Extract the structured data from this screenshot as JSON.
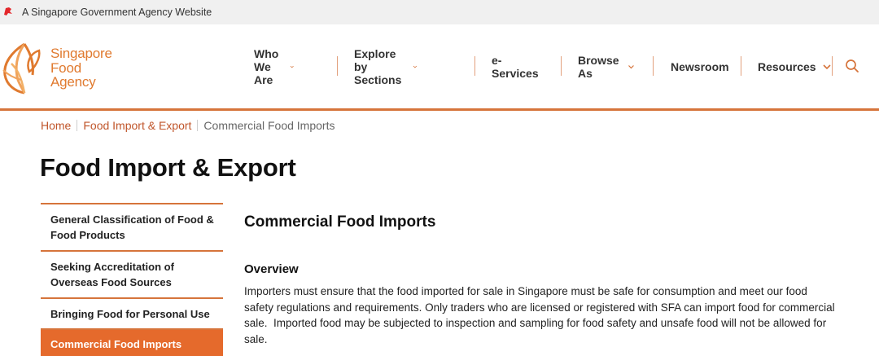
{
  "gov_bar": {
    "text": "A Singapore Government Agency Website",
    "logo_icon": "singapore-lion-icon",
    "logo_color": "#e3262a"
  },
  "logo": {
    "line1": "Singapore",
    "line2": "Food",
    "line3": "Agency",
    "color": "#e07a2f"
  },
  "nav": {
    "items": [
      {
        "label": "Who We Are",
        "has_dropdown": true
      },
      {
        "label": "Explore by Sections",
        "has_dropdown": true
      },
      {
        "label": "e-Services",
        "has_dropdown": false
      },
      {
        "label": "Browse As",
        "has_dropdown": true
      },
      {
        "label": "Newsroom",
        "has_dropdown": false
      },
      {
        "label": "Resources",
        "has_dropdown": true
      }
    ],
    "search_icon": "search-icon"
  },
  "breadcrumb": {
    "home": "Home",
    "section": "Food Import & Export",
    "current": "Commercial Food Imports"
  },
  "page_title": "Food Import & Export",
  "side_nav": {
    "items": [
      {
        "label": "General Classification of Food & Food Products"
      },
      {
        "label": "Seeking Accreditation of Overseas Food Sources"
      },
      {
        "label": "Bringing Food for Personal Use"
      },
      {
        "label": "Commercial Food Imports",
        "active": true
      }
    ]
  },
  "content": {
    "title": "Commercial Food Imports",
    "overview_heading": "Overview",
    "overview_body": "Importers must ensure that the food imported for sale in Singapore must be safe for consumption and meet our food safety regulations and requirements. Only traders who are licensed or registered with SFA can import food for commercial sale.  Imported food may be subjected to inspection and sampling for food safety and unsafe food will not be allowed for sale."
  },
  "colors": {
    "accent": "#d6743b",
    "active_bg": "#e56a2c",
    "link": "#c0552a"
  }
}
